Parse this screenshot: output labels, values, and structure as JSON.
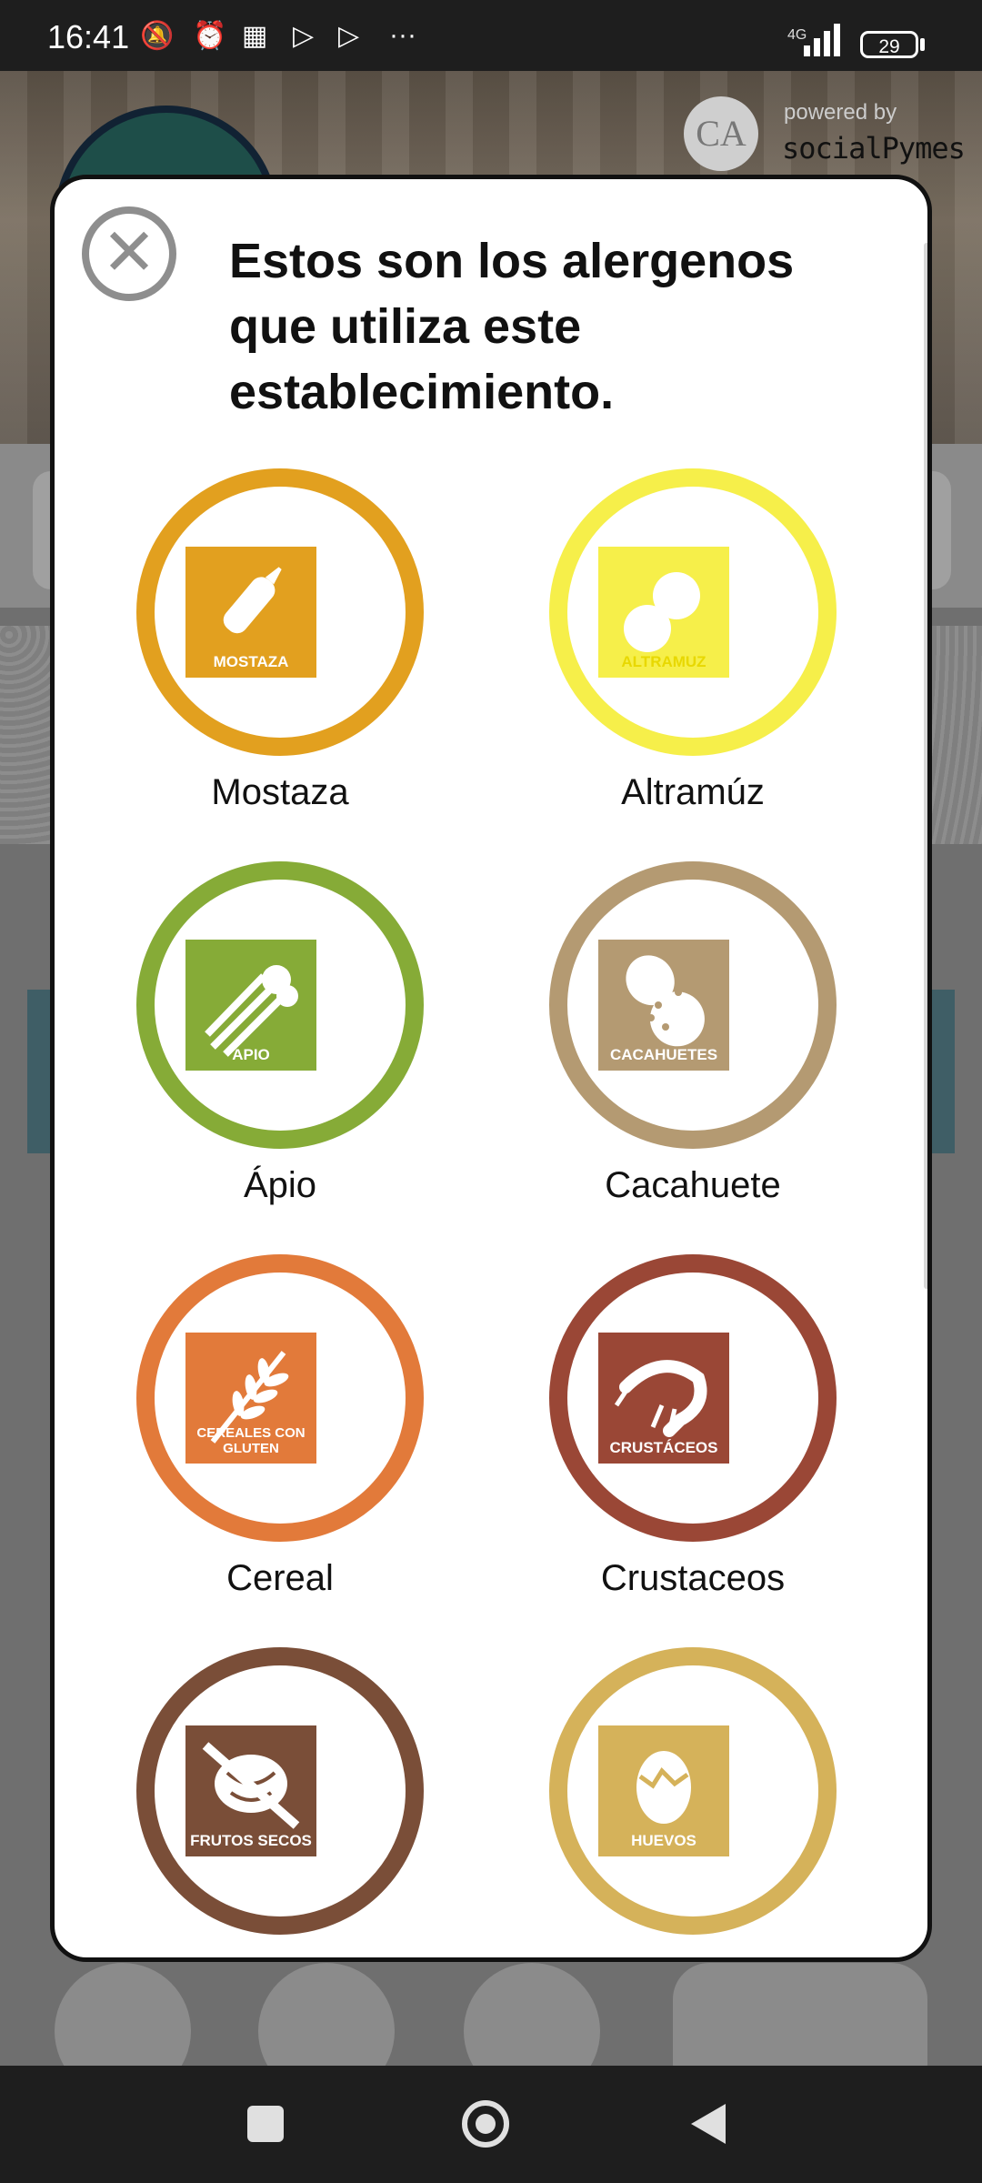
{
  "status_bar": {
    "time": "16:41",
    "network": "4G",
    "battery": "29"
  },
  "background": {
    "powered_by": "powered by",
    "brand": "socialPymes",
    "badge": "CA"
  },
  "modal": {
    "close_symbol": "✕",
    "title": "Estos son los alergenos que utiliza este establecimiento.",
    "allergens": [
      {
        "name": "Mostaza",
        "caption": "MOSTAZA",
        "color": "#e2a01f",
        "icon": "mustard-bottle-icon"
      },
      {
        "name": "Altramúz",
        "caption": "ALTRAMUZ",
        "color": "#f6ef4a",
        "icon": "lupin-icon"
      },
      {
        "name": "Ápio",
        "caption": "APIO",
        "color": "#86ab37",
        "icon": "celery-icon"
      },
      {
        "name": "Cacahuete",
        "caption": "CACAHUETES",
        "color": "#b49a72",
        "icon": "peanut-icon"
      },
      {
        "name": "Cereal",
        "caption": "CEREALES CON GLUTEN",
        "color": "#e27a3a",
        "icon": "wheat-icon"
      },
      {
        "name": "Crustaceos",
        "caption": "CRUSTÁCEOS",
        "color": "#9a4736",
        "icon": "shrimp-icon"
      },
      {
        "name": "",
        "caption": "FRUTOS SECOS",
        "color": "#7a4e38",
        "icon": "nuts-icon"
      },
      {
        "name": "",
        "caption": "HUEVOS",
        "color": "#d5b25a",
        "icon": "egg-icon"
      }
    ]
  }
}
